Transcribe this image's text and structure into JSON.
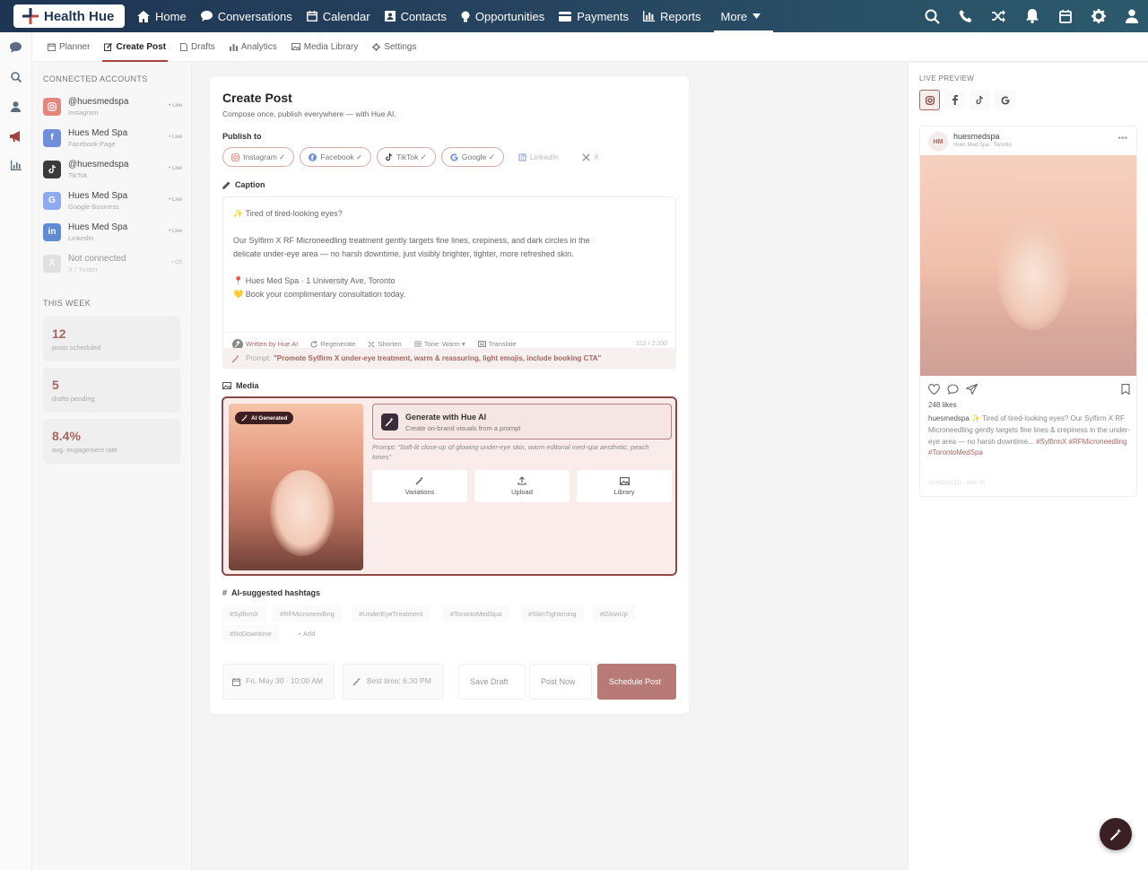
{
  "app": {
    "name": "Health Hue"
  },
  "nav": [
    {
      "label": "Home",
      "icon": "home-icon"
    },
    {
      "label": "Conversations",
      "icon": "chat-icon"
    },
    {
      "label": "Calendar",
      "icon": "calendar-icon"
    },
    {
      "label": "Contacts",
      "icon": "contacts-icon"
    },
    {
      "label": "Opportunities",
      "icon": "opportunities-icon"
    },
    {
      "label": "Payments",
      "icon": "payments-icon"
    },
    {
      "label": "Reports",
      "icon": "reports-icon"
    },
    {
      "label": "More",
      "icon": "caret-down-icon"
    }
  ],
  "subnav": [
    {
      "label": "Planner"
    },
    {
      "label": "Create Post"
    },
    {
      "label": "Drafts"
    },
    {
      "label": "Analytics"
    },
    {
      "label": "Media Library"
    },
    {
      "label": "Settings"
    }
  ],
  "accounts": {
    "title": "CONNECTED ACCOUNTS",
    "items": [
      {
        "name": "@huesmedspa",
        "platform": "Instagram",
        "status": "• Live",
        "letter": "",
        "color": "#e5867e"
      },
      {
        "name": "Hues Med Spa",
        "platform": "Facebook Page",
        "status": "• Live",
        "letter": "f",
        "color": "#6f8fdd"
      },
      {
        "name": "@huesmedspa",
        "platform": "TikTok",
        "status": "• Live",
        "letter": "",
        "color": "#3b3b3b"
      },
      {
        "name": "Hues Med Spa",
        "platform": "Google Business",
        "status": "• Live",
        "letter": "G",
        "color": "#8eaaf0"
      },
      {
        "name": "Hues Med Spa",
        "platform": "LinkedIn",
        "status": "• Live",
        "letter": "in",
        "color": "#5f8bd3"
      },
      {
        "name": "Not connected",
        "platform": "X / Twitter",
        "status": "• Off",
        "letter": "X",
        "color": "#cfcfcf"
      }
    ]
  },
  "week": {
    "title": "THIS WEEK",
    "stats": [
      {
        "value": "12",
        "label": "posts scheduled"
      },
      {
        "value": "5",
        "label": "drafts pending"
      },
      {
        "value": "8.4%",
        "label": "avg. engagement rate"
      }
    ]
  },
  "create": {
    "title": "Create Post",
    "subtitle": "Compose once, publish everywhere — with Hue AI.",
    "publish_label": "Publish to",
    "channels": [
      {
        "label": "Instagram",
        "check": "✓"
      },
      {
        "label": "Facebook",
        "check": "✓"
      },
      {
        "label": "TikTok",
        "check": "✓"
      },
      {
        "label": "Google",
        "check": "✓"
      },
      {
        "label": "LinkedIn",
        "check": ""
      },
      {
        "label": "X",
        "check": ""
      }
    ],
    "caption_label": "Caption",
    "caption_lines": [
      "✨ Tired of tired-looking eyes?",
      "",
      "Our Sylfirm X RF Microneedling treatment gently targets fine lines, crepiness, and dark circles in the",
      "delicate under-eye area — no harsh downtime, just visibly brighter, tighter, more refreshed skin.",
      "",
      "📍 Hues Med Spa · 1 University Ave, Toronto",
      "💛 Book your complimentary consultation today."
    ],
    "tools": {
      "written": "Written by Hue AI",
      "regenerate": "Regenerate",
      "shorten": "Shorten",
      "tone": "Tone: Warm ▾",
      "translate": "Translate",
      "count": "312 / 2,200"
    },
    "prompt_label": "Prompt:",
    "prompt_text": "\"Promote Sylfirm X under-eye treatment, warm & reassuring, light emojis, include booking CTA\"",
    "media_label": "Media",
    "media": {
      "badge": "AI Generated",
      "gen_title": "Generate with Hue AI",
      "gen_sub": "Create on-brand visuals from a prompt",
      "prompt": "Prompt: \"Soft-lit close-up of glowing under-eye skin, warm editorial med-spa aesthetic, peach tones\"",
      "buttons": [
        {
          "label": "Variations"
        },
        {
          "label": "Upload"
        },
        {
          "label": "Library"
        }
      ]
    },
    "hashtags_label": "AI-suggested hashtags",
    "hashtags": [
      "#SylfirmX",
      "#RFMicroneedling",
      "#UnderEyeTreatment",
      "#TorontoMedSpa",
      "#SkinTightening",
      "#GlowUp",
      "#NoDowntime",
      "+ Add"
    ],
    "footer": {
      "date": "Fri, May 30 · 10:00 AM",
      "best_time": "Best time: 6:30 PM",
      "save_draft": "Save Draft",
      "post_now": "Post Now",
      "schedule": "Schedule Post"
    }
  },
  "preview": {
    "title": "LIVE PREVIEW",
    "avatar": "HM",
    "user": "huesmedspa",
    "location": "Hues Med Spa · Toronto",
    "likes": "248 likes",
    "caption_user": "huesmedspa",
    "caption_text": " ✨ Tired of tired-looking eyes? Our Sylfirm X RF Microneedling gently targets fine lines & crepiness in the under-eye area — no harsh downtime...",
    "caption_tags": " #SylfirmX #RFMicroneedling #TorontoMedSpa",
    "time": "SCHEDULED · MAY 30"
  },
  "colors": {
    "accent": "#a66661",
    "primary_button": "#b87a76",
    "topbar": "#1e3553"
  }
}
